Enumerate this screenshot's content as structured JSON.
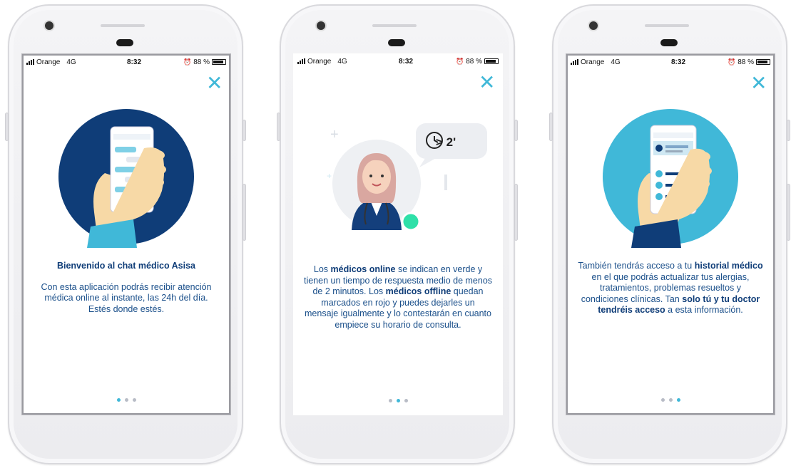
{
  "phones": [
    {
      "status": {
        "carrier": "Orange",
        "network": "4G",
        "time": "8:32",
        "battery": "88 %"
      },
      "close_icon": "close-icon",
      "title": "Bienvenido al chat médico Asisa",
      "body": "Con esta aplicación podrás recibir atención médica online al instante, las 24h del día. Estés donde estés.",
      "pager": {
        "current": 1,
        "total": 3
      }
    },
    {
      "status": {
        "carrier": "Orange",
        "network": "4G",
        "time": "8:32",
        "battery": "88 %"
      },
      "close_icon": "close-icon",
      "bubble": "> 2'",
      "body_parts": [
        {
          "t": "Los ",
          "b": false
        },
        {
          "t": "médicos online",
          "b": true
        },
        {
          "t": " se indican en verde y tienen un tiempo de respuesta medio de menos de 2 minutos. Los ",
          "b": false
        },
        {
          "t": "médicos offline",
          "b": true
        },
        {
          "t": " quedan marcados en rojo y puedes dejarles un mensaje igualmente y lo contestarán en cuanto empiece su horario de consulta.",
          "b": false
        }
      ],
      "pager": {
        "current": 2,
        "total": 3
      }
    },
    {
      "status": {
        "carrier": "Orange",
        "network": "4G",
        "time": "8:32",
        "battery": "88 %"
      },
      "close_icon": "close-icon",
      "body_parts": [
        {
          "t": "También tendrás acceso a tu ",
          "b": false
        },
        {
          "t": "historial médico",
          "b": true
        },
        {
          "t": " en el que podrás actualizar tus alergias, tratamientos, problemas resueltos y condiciones clínicas. Tan ",
          "b": false
        },
        {
          "t": "solo tú y tu doctor tendréis acceso",
          "b": true
        },
        {
          "t": " a esta información.",
          "b": false
        }
      ],
      "pager": {
        "current": 3,
        "total": 3
      }
    }
  ],
  "colors": {
    "accent": "#40b8d8",
    "navy": "#0f3d78",
    "text": "#1a4f8a",
    "online": "#2ee0a8"
  }
}
